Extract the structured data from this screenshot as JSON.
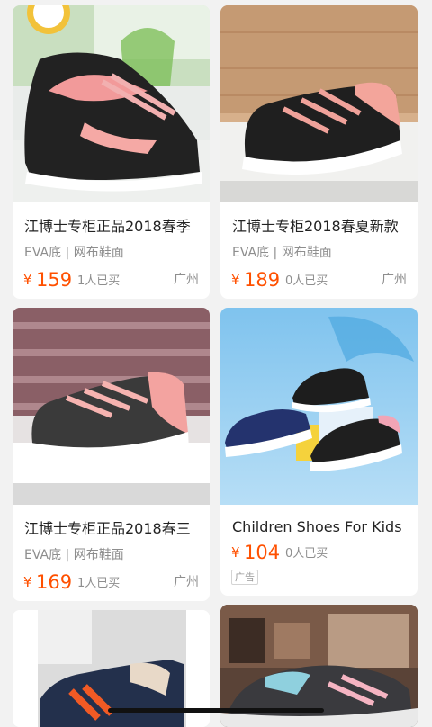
{
  "products": [
    {
      "title": "江博士专柜正品2018春季",
      "attrs": "EVA底 | 网布鞋面",
      "currency": "¥",
      "price": "159",
      "sold": "1人已买",
      "location": "广州",
      "image_icon": "pink-black-kids-sneaker-image"
    },
    {
      "title": "江博士专柜2018春夏新款",
      "attrs": "EVA底 | 网布鞋面",
      "currency": "¥",
      "price": "189",
      "sold": "0人已买",
      "location": "广州",
      "image_icon": "black-pink-kids-sneaker-image"
    },
    {
      "title": "江博士专柜正品2018春三",
      "attrs": "EVA底 | 网布鞋面",
      "currency": "¥",
      "price": "169",
      "sold": "1人已买",
      "location": "广州",
      "image_icon": "gray-pink-kids-sneaker-image"
    },
    {
      "title": "Children Shoes For Kids",
      "currency": "¥",
      "price": "104",
      "sold": "0人已买",
      "ad_tag": "广告",
      "image_icon": "navy-and-black-sneakers-ad-image"
    }
  ],
  "colors": {
    "accent": "#ff5000",
    "muted": "#8e8e8e",
    "background": "#f2f2f2"
  }
}
